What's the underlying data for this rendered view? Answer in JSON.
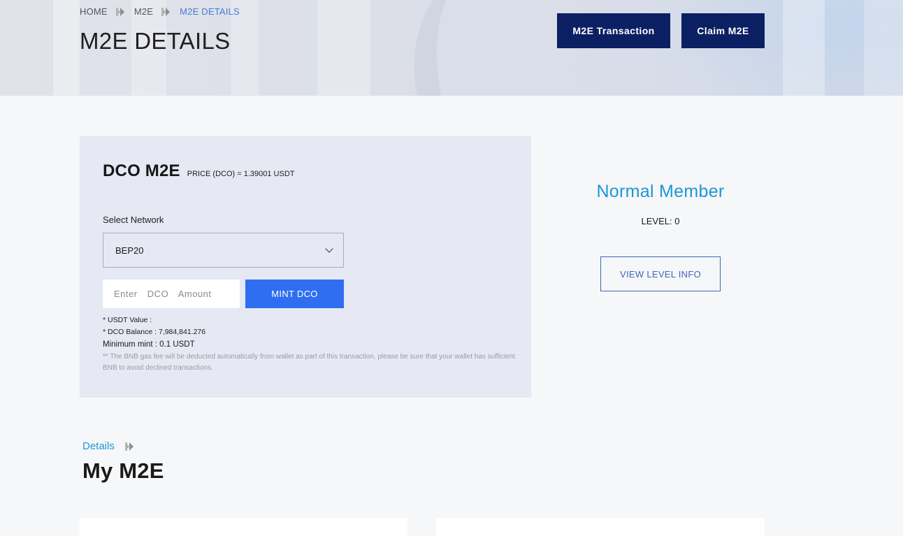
{
  "breadcrumb": {
    "items": [
      "HOME",
      "M2E",
      "M2E DETAILS"
    ],
    "separator_icon": "double-chevron-right-icon"
  },
  "header": {
    "title": "M2E DETAILS",
    "buttons": {
      "transaction_label": "M2E Transaction",
      "claim_label": "Claim M2E"
    }
  },
  "mint": {
    "title": "DCO M2E",
    "price": "PRICE (DCO) = 1.39001 USDT",
    "network_label": "Select Network",
    "network_selected": "BEP20",
    "amount_placeholder": "Enter  DCO  Amount",
    "amount_value": "",
    "mint_label": "MINT DCO",
    "usdt_value": "* USDT Value :",
    "dco_balance": "* DCO Balance : 7,984,841.276",
    "minimum_mint": "Minimum mint : 0.1 USDT",
    "gas_note": "** The BNB gas fee will be deducted automatically from wallet as part of this transaction, please be sure that your wallet has sufficient BNB to avoid declined transactions."
  },
  "member": {
    "title": "Normal Member",
    "level": "LEVEL: 0",
    "view_label": "VIEW LEVEL INFO"
  },
  "details": {
    "label": "Details",
    "title": "My M2E"
  },
  "colors": {
    "primary_dark": "#0b1f63",
    "accent_blue": "#2f6ef0",
    "member_blue": "#1e96d6",
    "card_bg": "#e6e8f3"
  }
}
